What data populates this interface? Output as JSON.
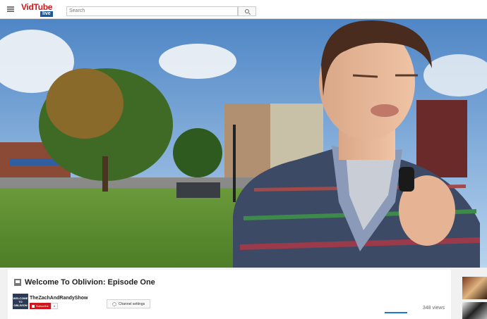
{
  "header": {
    "logo_main": "VidTube",
    "logo_sub": "live",
    "search_placeholder": "Search"
  },
  "video": {
    "title": "Welcome To Oblivion: Episode One",
    "channel_name": "TheZachAndRandyShow",
    "thumbnail_text": "WELCOME TO OBLIVION",
    "subscribe_label": "Subscribe",
    "subscriber_count": "4",
    "channel_settings_label": "Channel settings",
    "views": "348 views",
    "like_ratio": 1.0
  },
  "colors": {
    "accent_red": "#cc181e",
    "accent_blue": "#167ac6"
  },
  "icons": {
    "menu": "menu-icon",
    "search": "search-icon",
    "settings": "gear-icon"
  }
}
